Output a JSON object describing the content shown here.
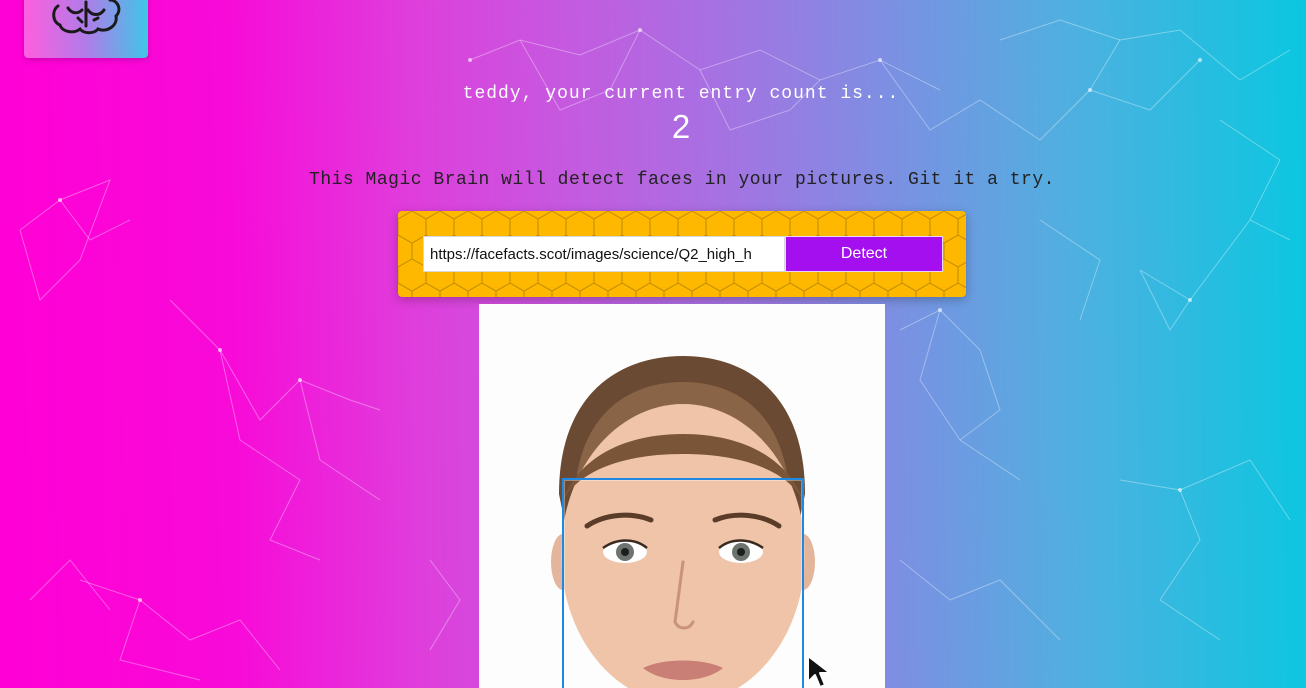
{
  "app": {
    "logo_icon": "brain-icon"
  },
  "rank": {
    "message": "teddy, your current entry count is...",
    "count": "2"
  },
  "intro": {
    "text": "This Magic Brain will detect faces in your pictures. Git it a try."
  },
  "image_form": {
    "url_value": "https://facefacts.scot/images/science/Q2_high_h",
    "detect_label": "Detect"
  },
  "colors": {
    "form_background": "#ffb800",
    "detect_button": "#a40ff0",
    "face_box": "#1e88e5",
    "gradient_left": "#ff00d6",
    "gradient_right": "#0ac7e0"
  },
  "result": {
    "face_image": "woman-portrait",
    "faces_detected": 1
  }
}
